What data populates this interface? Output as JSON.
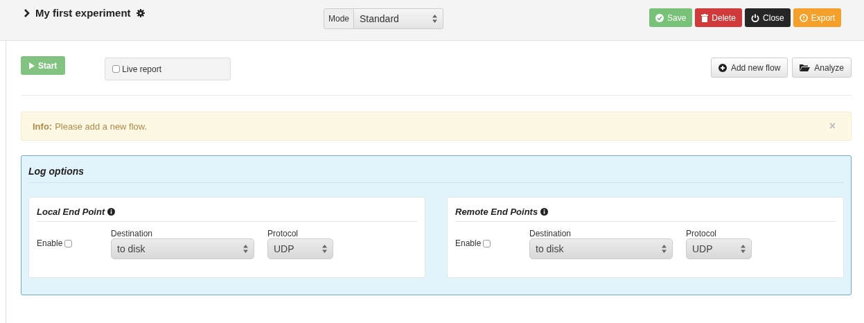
{
  "header": {
    "title": "My first experiment",
    "mode": {
      "label": "Mode",
      "value": "Standard"
    },
    "actions": [
      {
        "label": "Save",
        "kind": "save"
      },
      {
        "label": "Delete",
        "kind": "delete"
      },
      {
        "label": "Close",
        "kind": "close"
      },
      {
        "label": "Export",
        "kind": "export"
      }
    ]
  },
  "toolbar": {
    "start": "Start",
    "live_report": {
      "label": "Live report",
      "checked": false
    },
    "buttons": [
      {
        "label": "Add new flow",
        "kind": "add"
      },
      {
        "label": "Analyze",
        "kind": "analyze"
      }
    ]
  },
  "alert": {
    "title": "Info:",
    "message": "Please add a new flow.",
    "close": "×"
  },
  "log_options": {
    "title": "Log options",
    "panels": [
      {
        "title": "Local End Point",
        "enable": {
          "label": "Enable",
          "checked": false
        },
        "destination": {
          "label": "Destination",
          "value": "to disk"
        },
        "protocol": {
          "label": "Protocol",
          "value": "UDP"
        }
      },
      {
        "title": "Remote End Points",
        "enable": {
          "label": "Enable",
          "checked": false
        },
        "destination": {
          "label": "Destination",
          "value": "to disk"
        },
        "protocol": {
          "label": "Protocol",
          "value": "UDP"
        }
      }
    ]
  }
}
